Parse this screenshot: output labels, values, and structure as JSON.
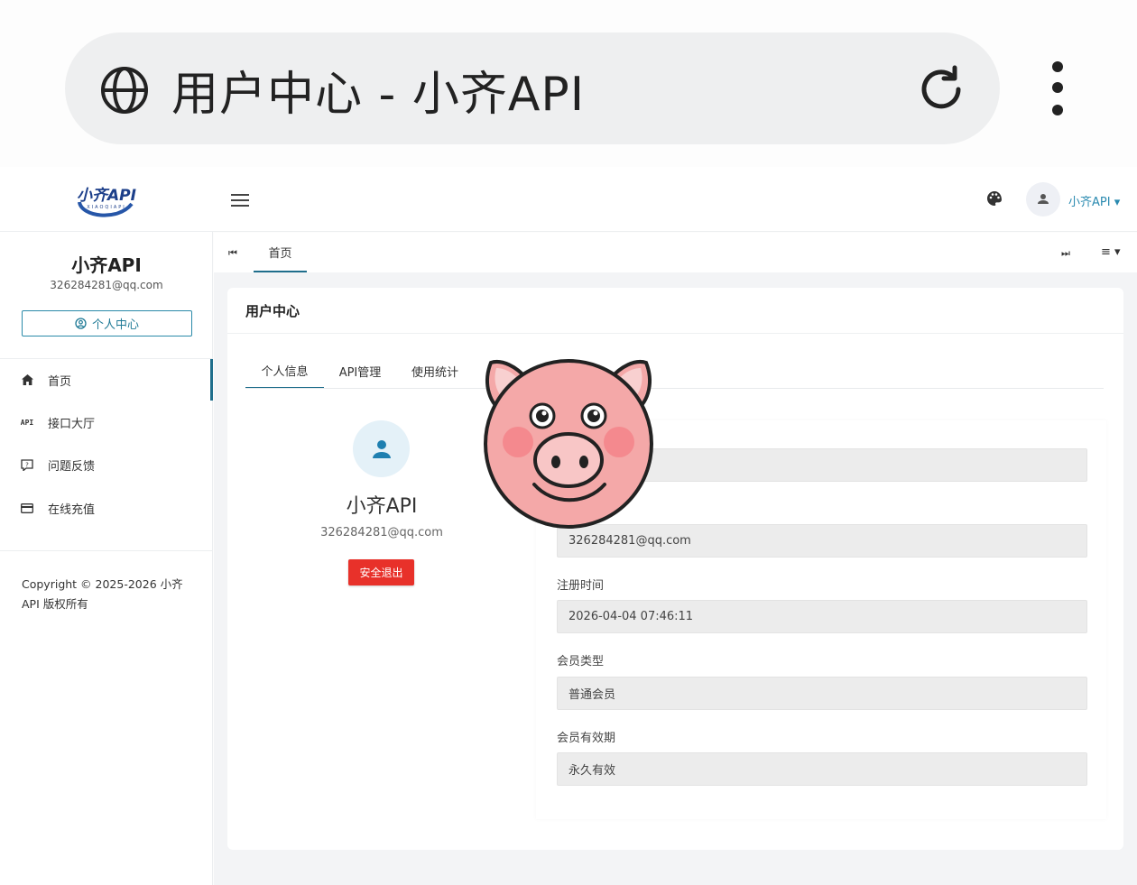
{
  "browser": {
    "title": "用户中心 - 小齐API",
    "icons": [
      "globe-icon",
      "reload-icon",
      "kebab-menu-icon"
    ]
  },
  "header": {
    "logo_text": "小齐API",
    "logo_subtext": "XIAOQIAPI",
    "user_label": "小齐API ▾"
  },
  "sidebar": {
    "name": "小齐API",
    "email": "326284281@qq.com",
    "center_button": "个人中心",
    "items": [
      {
        "label": "首页",
        "icon": "home-icon"
      },
      {
        "label": "接口大厅",
        "icon": "api-icon"
      },
      {
        "label": "问题反馈",
        "icon": "feedback-icon"
      },
      {
        "label": "在线充值",
        "icon": "credit-card-icon"
      }
    ],
    "copyright": "Copyright © 2025-2026 小齐API 版权所有"
  },
  "tabstrip": {
    "prev": "⏮",
    "home": "首页",
    "next": "⏭",
    "menu": "≡ ▾"
  },
  "card": {
    "title": "用户中心",
    "tabs": [
      "个人信息",
      "API管理",
      "使用统计"
    ],
    "profile": {
      "name": "小齐API",
      "email": "326284281@qq.com",
      "logout": "安全退出"
    },
    "fields": [
      {
        "label": "",
        "value": ""
      },
      {
        "label": "",
        "value": "326284281@qq.com"
      },
      {
        "label": "注册时间",
        "value": "2026-04-04 07:46:11"
      },
      {
        "label": "会员类型",
        "value": "普通会员"
      },
      {
        "label": "会员有效期",
        "value": "永久有效"
      }
    ]
  },
  "overlay": {
    "icon": "pig-sticker-icon"
  },
  "colors": {
    "accent": "#1f6e8c",
    "logout": "#e8312a",
    "input_bg": "#ececec",
    "pig_pink": "#f4a8a8"
  }
}
